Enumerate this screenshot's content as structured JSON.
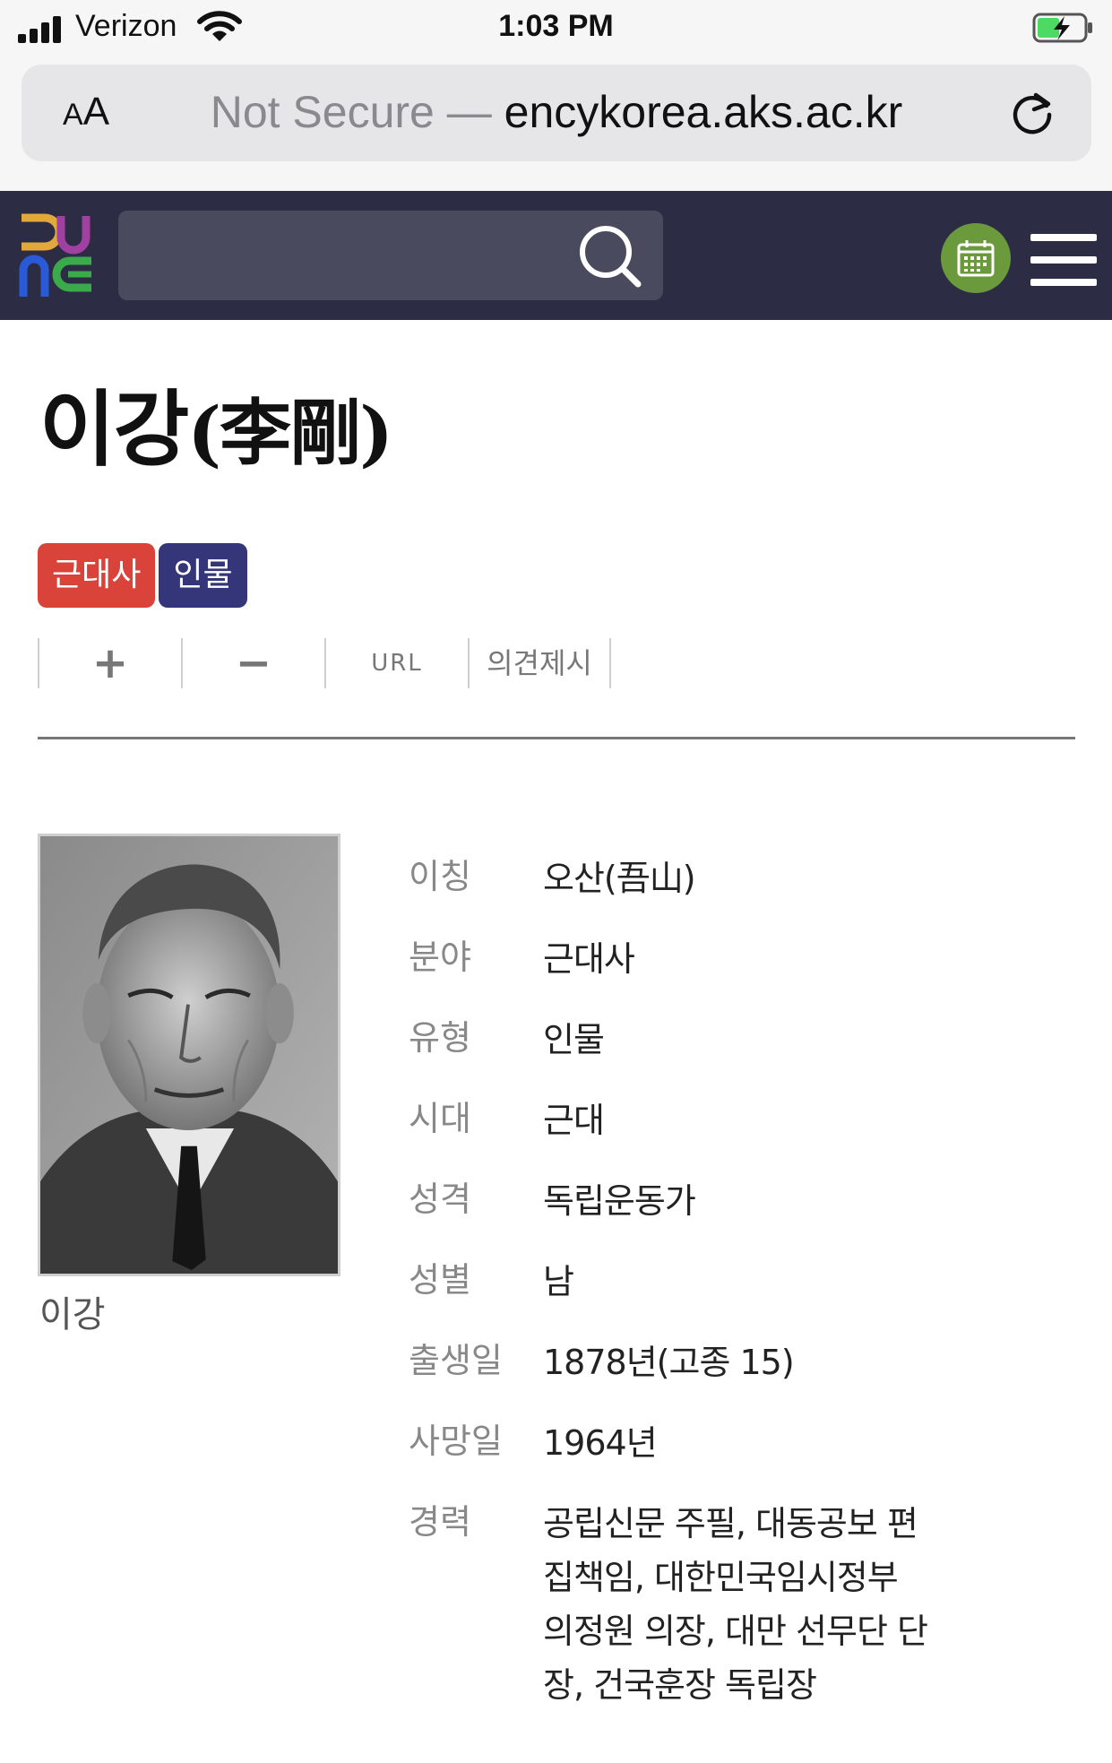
{
  "status_bar": {
    "carrier": "Verizon",
    "time": "1:03 PM"
  },
  "safari": {
    "aa_label": "AA",
    "url_prefix": "Not Secure —",
    "url_host": "encykorea.aks.ac.kr"
  },
  "header": {
    "search_placeholder": ""
  },
  "article": {
    "title": "이강",
    "title_hanja": "(李剛)",
    "tags": [
      {
        "label": "근대사",
        "color": "#d9433a"
      },
      {
        "label": "인물",
        "color": "#35357a"
      }
    ],
    "tools": {
      "plus": "+",
      "minus": "−",
      "url": "URL",
      "feedback": "의견제시"
    },
    "portrait_caption": "이강",
    "info": [
      {
        "label": "이칭",
        "value": "오산(吾山)"
      },
      {
        "label": "분야",
        "value": "근대사"
      },
      {
        "label": "유형",
        "value": "인물"
      },
      {
        "label": "시대",
        "value": "근대"
      },
      {
        "label": "성격",
        "value": "독립운동가"
      },
      {
        "label": "성별",
        "value": "남"
      },
      {
        "label": "출생일",
        "value": "1878년(고종 15)"
      },
      {
        "label": "사망일",
        "value": "1964년"
      },
      {
        "label": "경력",
        "value": "공립신문 주필, 대동공보 편집책임, 대한민국임시정부 의정원 의장, 대만 선무단 단장, 건국훈장 독립장"
      }
    ]
  },
  "colors": {
    "header_bg": "#2c2c44",
    "calendar_green": "#6a9a3c",
    "tag_red": "#d9433a",
    "tag_navy": "#35357a"
  }
}
